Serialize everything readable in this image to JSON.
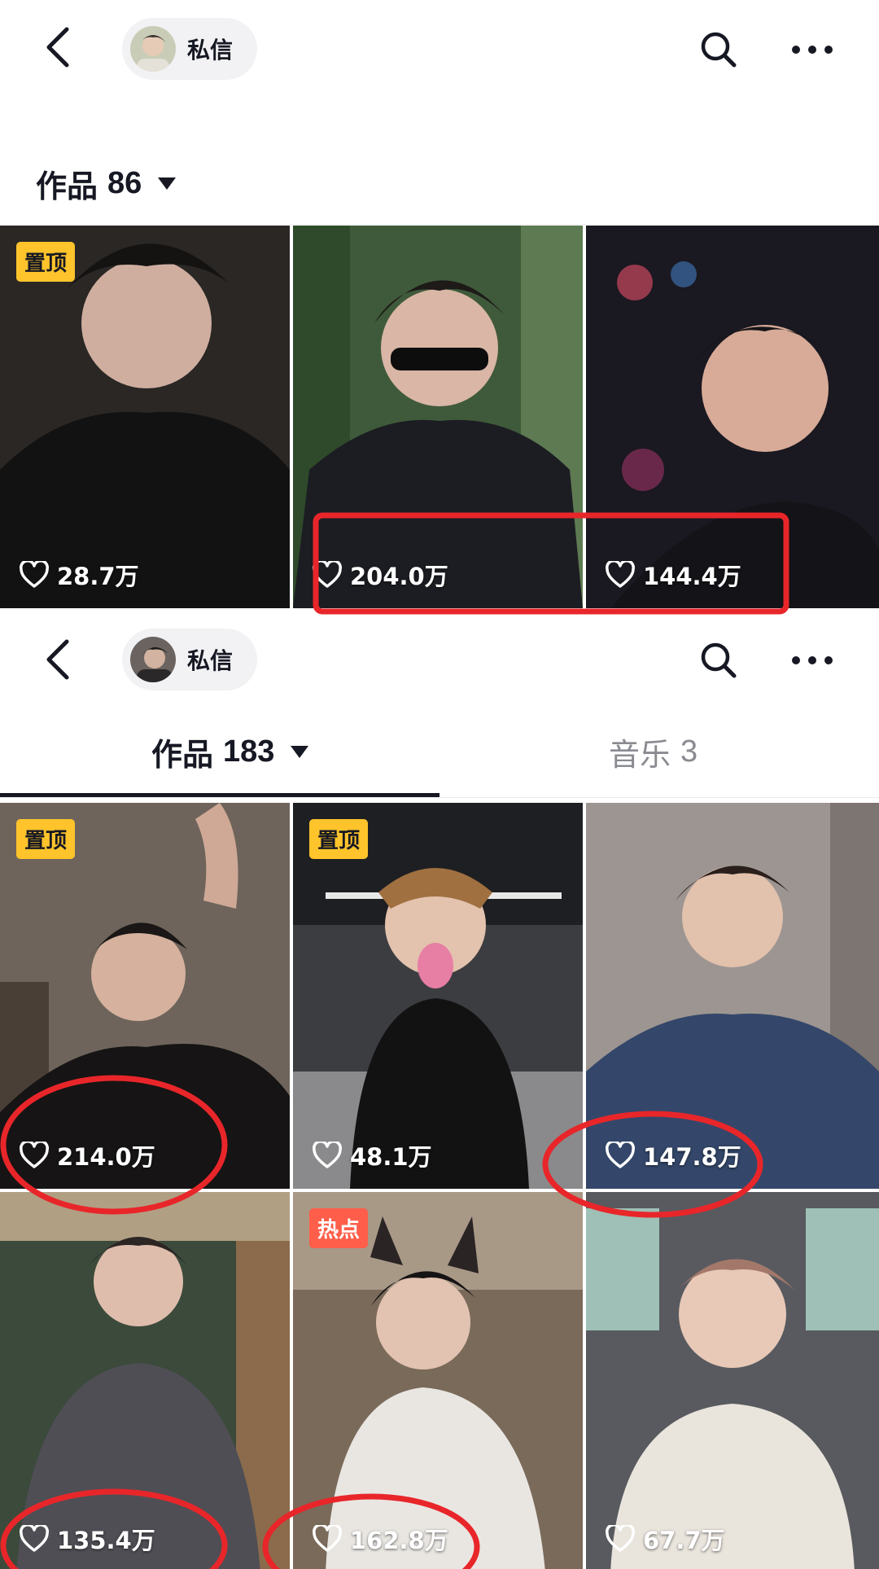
{
  "screen1": {
    "dm_label": "私信",
    "tab": {
      "label": "作品",
      "count": "86"
    },
    "videos": [
      {
        "likes": "28.7万",
        "badge": "置顶"
      },
      {
        "likes": "204.0万"
      },
      {
        "likes": "144.4万"
      }
    ]
  },
  "screen2": {
    "dm_label": "私信",
    "tabs": [
      {
        "label": "作品",
        "count": "183"
      },
      {
        "label": "音乐",
        "count": "3"
      }
    ],
    "videos": [
      {
        "likes": "214.0万",
        "badge": "置顶"
      },
      {
        "likes": "48.1万",
        "badge": "置顶"
      },
      {
        "likes": "147.8万"
      },
      {
        "likes": "135.4万"
      },
      {
        "likes": "162.8万",
        "badge": "热点"
      },
      {
        "likes": "67.7万"
      }
    ]
  },
  "colors": {
    "pin_badge": "#ffc42c",
    "hot_badge": "#fe5e4a",
    "annotation": "#e8262a"
  },
  "icons": [
    "back-arrow-icon",
    "search-icon",
    "more-icon",
    "heart-icon",
    "dropdown-caret-icon"
  ]
}
